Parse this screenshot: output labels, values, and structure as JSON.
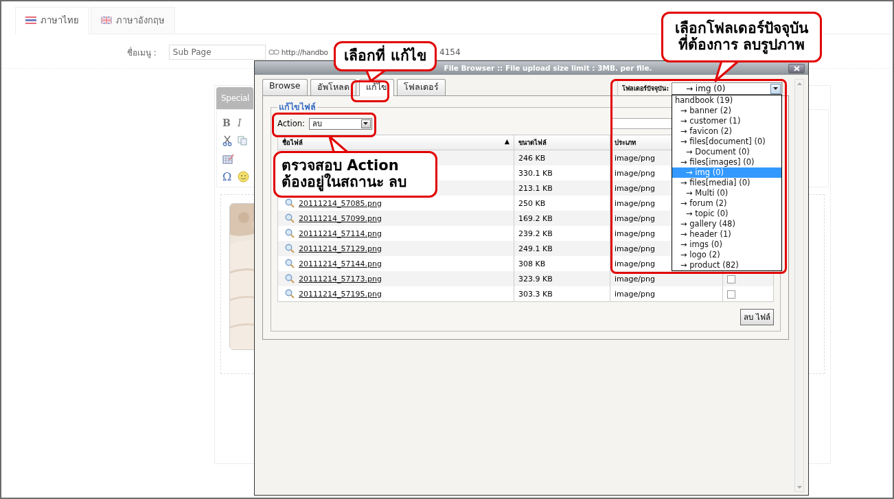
{
  "language_tabs": [
    {
      "label": "ภาษาไทย",
      "kind": "th",
      "selected": true
    },
    {
      "label": "ภาษาอังกฤษ",
      "kind": "uk",
      "selected": false
    }
  ],
  "menu_form": {
    "label": "ชื่อเมนู :",
    "value": "Sub Page",
    "url_start": "http://handbo",
    "url_end": "4154"
  },
  "editor": {
    "tab": "Special",
    "glyphs": [
      "B",
      "I",
      "Ω"
    ]
  },
  "dialog": {
    "title": "File Browser :: File upload size limit : 3MB. per file.",
    "tabs": [
      {
        "label": "Browse",
        "selected": false
      },
      {
        "label": "อัพโหลด",
        "selected": false
      },
      {
        "label": "แก้ไข",
        "selected": true
      },
      {
        "label": "โฟลเดอร์",
        "selected": false
      }
    ],
    "folder": {
      "label": "โฟลเดอร์ปัจจุบัน:",
      "value": "→ img (0)",
      "expanded": true,
      "options": [
        {
          "label": "handbook (19)",
          "selected": false,
          "children": [
            {
              "label": "→ banner (2)",
              "selected": false
            },
            {
              "label": "→ customer (1)",
              "selected": false
            },
            {
              "label": "→ favicon (2)",
              "selected": false
            },
            {
              "label": "→ files[document] (0)",
              "selected": false,
              "children": [
                {
                  "label": "→ Document (0)",
                  "selected": false
                }
              ]
            },
            {
              "label": "→ files[images] (0)",
              "selected": false,
              "children": [
                {
                  "label": "→ img (0)",
                  "selected": true
                }
              ]
            },
            {
              "label": "→ files[media] (0)",
              "selected": false,
              "children": [
                {
                  "label": "→ Multi (0)",
                  "selected": false
                }
              ]
            },
            {
              "label": "→ forum (2)",
              "selected": false,
              "children": [
                {
                  "label": "→ topic (0)",
                  "selected": false
                }
              ]
            },
            {
              "label": "→ gallery (48)",
              "selected": false
            },
            {
              "label": "→ header (1)",
              "selected": false
            },
            {
              "label": "→ imgs (0)",
              "selected": false
            },
            {
              "label": "→ logo (2)",
              "selected": false
            },
            {
              "label": "→ product (82)",
              "selected": false
            }
          ]
        }
      ]
    },
    "legend": "แก้ไขไฟล์",
    "action": {
      "label": "Action:",
      "value": "ลบ"
    },
    "table": {
      "columns": [
        "ชื่อไฟล์",
        "ขนาดไฟล์",
        "ประเภท"
      ],
      "sort_mark": "▲",
      "rows": [
        {
          "size": "246 KB",
          "type": "image/png"
        },
        {
          "size": "330.1 KB",
          "type": "image/png"
        },
        {
          "size": "213.1 KB",
          "type": "image/png"
        },
        {
          "name": "20111214_57085.png",
          "size": "250 KB",
          "type": "image/png"
        },
        {
          "name": "20111214_57099.png",
          "size": "169.2 KB",
          "type": "image/png"
        },
        {
          "name": "20111214_57114.png",
          "size": "239.2 KB",
          "type": "image/png"
        },
        {
          "name": "20111214_57129.png",
          "size": "249.1 KB",
          "type": "image/png"
        },
        {
          "name": "20111214_57144.png",
          "size": "308 KB",
          "type": "image/png"
        },
        {
          "name": "20111214_57173.png",
          "size": "323.9 KB",
          "type": "image/png",
          "checked": false
        },
        {
          "name": "20111214_57195.png",
          "size": "303.3 KB",
          "type": "image/png",
          "checked": false
        }
      ]
    },
    "delete_button": "ลบ ไฟล์"
  },
  "callouts": [
    {
      "text": "เลือกที่ แก้ไข"
    },
    {
      "text": "ตรวจสอบ Action\nต้องอยู่ในสถานะ ลบ"
    },
    {
      "text": "เลือกโฟลเดอร์ปัจจุบัน\nที่ต้องการ ลบรูปภาพ"
    }
  ]
}
